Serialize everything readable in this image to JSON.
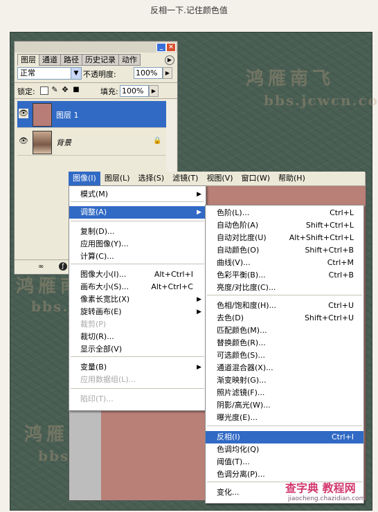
{
  "page": {
    "caption": "反相一下.记住颜色值"
  },
  "watermarks": {
    "cn_top": "鸿雁南飞",
    "en_top": "bbs.jcwcn.com",
    "cn_mid": "鸿雁南",
    "en_mid": "bbs.j",
    "cn_low": "鸿雁",
    "en_low": "bbs"
  },
  "layers_panel": {
    "tabs": [
      "图层",
      "通道",
      "路径",
      "历史记录",
      "动作"
    ],
    "blend_mode": "正常",
    "opacity_label": "不透明度:",
    "opacity_value": "100%",
    "lock_label": "锁定:",
    "fill_label": "填充:",
    "fill_value": "100%",
    "layers": [
      {
        "name": "图层 1",
        "selected": true,
        "thumb_color": "#b87d76"
      },
      {
        "name": "背景",
        "selected": false,
        "thumb_color": "#c8a88e"
      }
    ]
  },
  "menubar": {
    "items": [
      "图像(I)",
      "图层(L)",
      "选择(S)",
      "滤镜(T)",
      "视图(V)",
      "窗口(W)",
      "帮助(H)"
    ],
    "active_index": 0
  },
  "image_menu": {
    "items": [
      {
        "label": "模式(M)",
        "shortcut": "",
        "submenu": true,
        "disabled": false
      },
      {
        "label": "调整(A)",
        "shortcut": "",
        "submenu": true,
        "disabled": false,
        "highlighted": true
      },
      {
        "label": "复制(D)...",
        "shortcut": "",
        "disabled": false
      },
      {
        "label": "应用图像(Y)...",
        "shortcut": "",
        "disabled": false
      },
      {
        "label": "计算(C)...",
        "shortcut": "",
        "disabled": false
      },
      {
        "label": "图像大小(I)...",
        "shortcut": "Alt+Ctrl+I",
        "disabled": false
      },
      {
        "label": "画布大小(S)...",
        "shortcut": "Alt+Ctrl+C",
        "disabled": false
      },
      {
        "label": "像素长宽比(X)",
        "shortcut": "",
        "submenu": true,
        "disabled": false
      },
      {
        "label": "旋转画布(E)",
        "shortcut": "",
        "submenu": true,
        "disabled": false
      },
      {
        "label": "裁剪(P)",
        "shortcut": "",
        "disabled": true
      },
      {
        "label": "裁切(R)...",
        "shortcut": "",
        "disabled": false
      },
      {
        "label": "显示全部(V)",
        "shortcut": "",
        "disabled": false
      },
      {
        "label": "变量(B)",
        "shortcut": "",
        "submenu": true,
        "disabled": false
      },
      {
        "label": "应用数据组(L)...",
        "shortcut": "",
        "disabled": true
      },
      {
        "label": "陷印(T)...",
        "shortcut": "",
        "disabled": true
      }
    ]
  },
  "adjust_menu": {
    "items": [
      {
        "label": "色阶(L)...",
        "shortcut": "Ctrl+L"
      },
      {
        "label": "自动色阶(A)",
        "shortcut": "Shift+Ctrl+L"
      },
      {
        "label": "自动对比度(U)",
        "shortcut": "Alt+Shift+Ctrl+L"
      },
      {
        "label": "自动颜色(O)",
        "shortcut": "Shift+Ctrl+B"
      },
      {
        "label": "曲线(V)...",
        "shortcut": "Ctrl+M"
      },
      {
        "label": "色彩平衡(B)...",
        "shortcut": "Ctrl+B"
      },
      {
        "label": "亮度/对比度(C)...",
        "shortcut": ""
      },
      {
        "label": "色相/饱和度(H)...",
        "shortcut": "Ctrl+U"
      },
      {
        "label": "去色(D)",
        "shortcut": "Shift+Ctrl+U"
      },
      {
        "label": "匹配颜色(M)...",
        "shortcut": ""
      },
      {
        "label": "替换颜色(R)...",
        "shortcut": ""
      },
      {
        "label": "可选颜色(S)...",
        "shortcut": ""
      },
      {
        "label": "通道混合器(X)...",
        "shortcut": ""
      },
      {
        "label": "渐变映射(G)...",
        "shortcut": ""
      },
      {
        "label": "照片滤镜(F)...",
        "shortcut": ""
      },
      {
        "label": "阴影/高光(W)...",
        "shortcut": ""
      },
      {
        "label": "曝光度(E)...",
        "shortcut": ""
      },
      {
        "label": "反相(I)",
        "shortcut": "Ctrl+I",
        "highlighted": true
      },
      {
        "label": "色调均化(Q)",
        "shortcut": ""
      },
      {
        "label": "阈值(T)...",
        "shortcut": ""
      },
      {
        "label": "色调分离(P)...",
        "shortcut": ""
      },
      {
        "label": "变化...",
        "shortcut": ""
      }
    ]
  },
  "canvas": {
    "fill_color": "#b98078"
  },
  "logo": {
    "main": "查字典 教程网",
    "sub": "jiaocheng.chazidian.com"
  }
}
